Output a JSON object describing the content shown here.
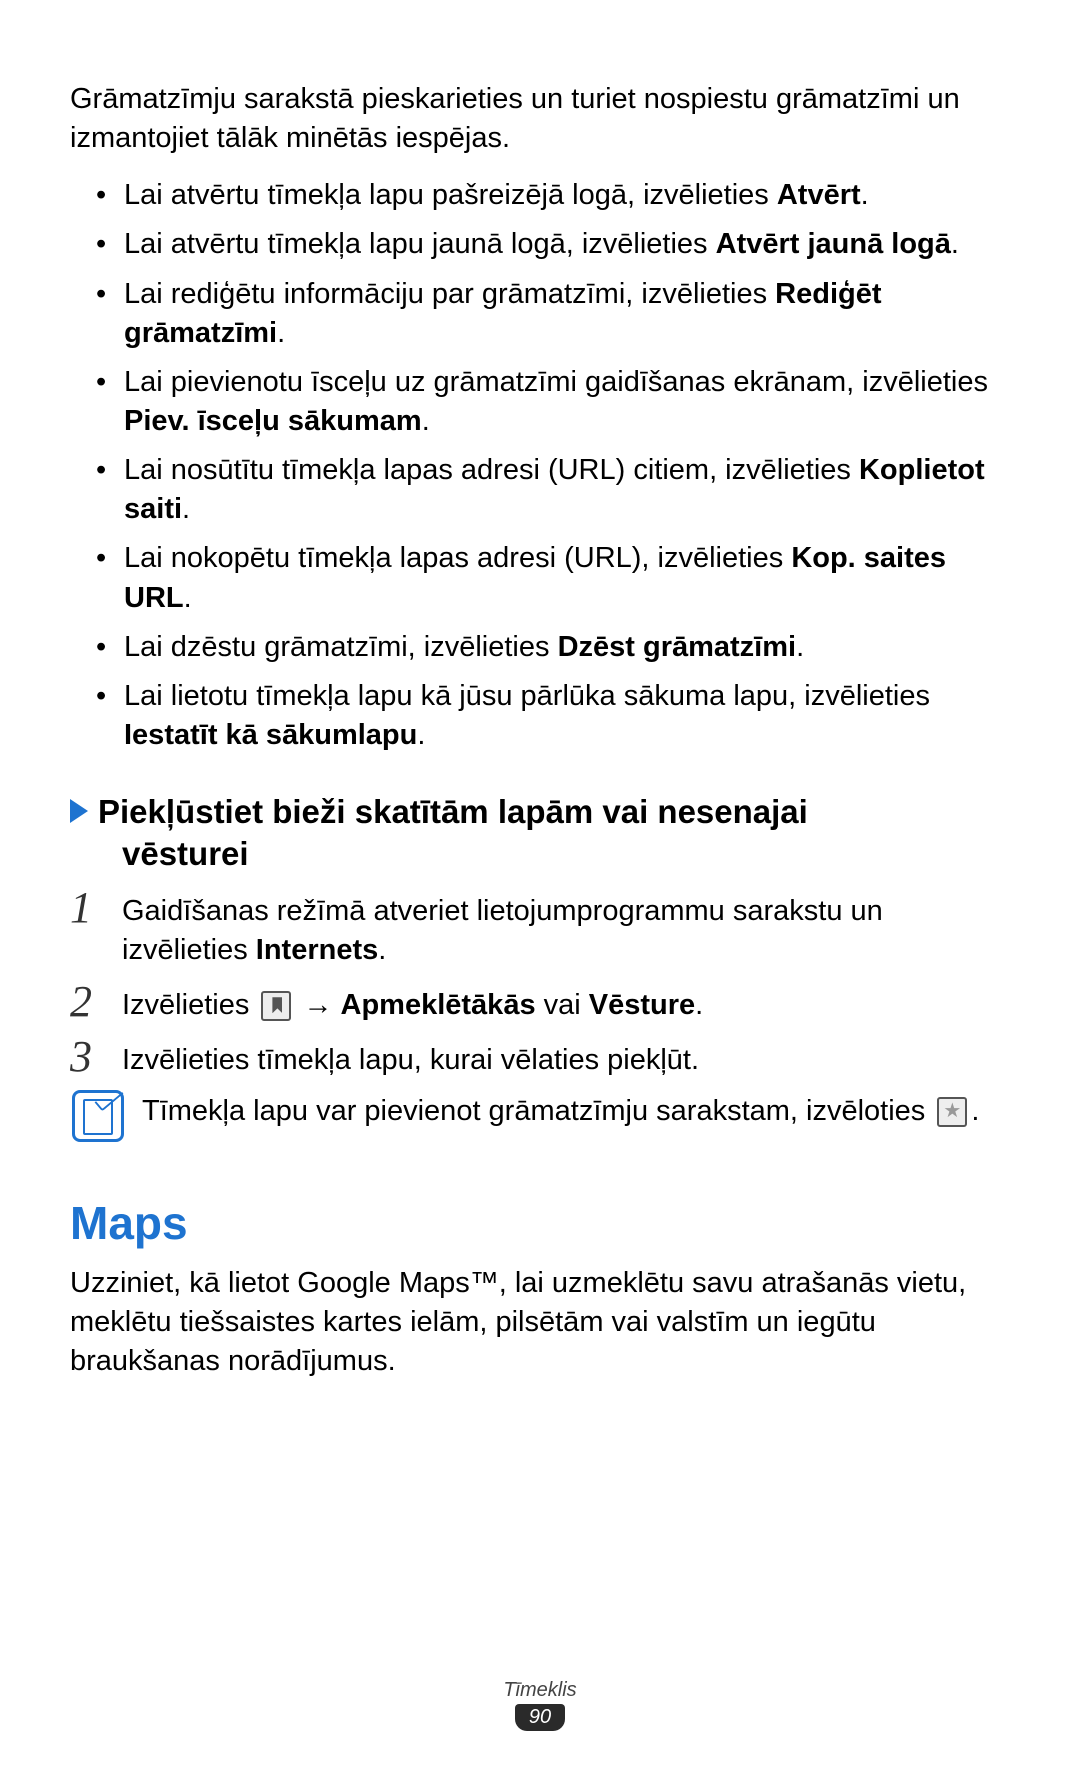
{
  "intro": "Grāmatzīmju sarakstā pieskarieties un turiet nospiestu grāmatzīmi un izmantojiet tālāk minētās iespējas.",
  "bullets": [
    {
      "t": "Lai atvērtu tīmekļa lapu pašreizējā logā, izvēlieties ",
      "b": "Atvērt",
      "a": "."
    },
    {
      "t": "Lai atvērtu tīmekļa lapu jaunā logā, izvēlieties ",
      "b": "Atvērt jaunā logā",
      "a": "."
    },
    {
      "t": "Lai rediģētu informāciju par grāmatzīmi, izvēlieties ",
      "b": "Rediģēt grāmatzīmi",
      "a": "."
    },
    {
      "t": "Lai pievienotu īsceļu uz grāmatzīmi gaidīšanas ekrānam, izvēlieties ",
      "b": "Piev. īsceļu sākumam",
      "a": "."
    },
    {
      "t": "Lai nosūtītu tīmekļa lapas adresi (URL) citiem, izvēlieties ",
      "b": "Koplietot saiti",
      "a": "."
    },
    {
      "t": "Lai nokopētu tīmekļa lapas adresi (URL), izvēlieties ",
      "b": "Kop. saites URL",
      "a": "."
    },
    {
      "t": "Lai dzēstu grāmatzīmi, izvēlieties ",
      "b": "Dzēst grāmatzīmi",
      "a": "."
    },
    {
      "t": "Lai lietotu tīmekļa lapu kā jūsu pārlūka sākuma lapu, izvēlieties ",
      "b": "Iestatīt kā sākumlapu",
      "a": "."
    }
  ],
  "subhead_l1": "Piekļūstiet bieži skatītām lapām vai nesenajai",
  "subhead_l2": "vēsturei",
  "steps": {
    "s1": {
      "num": "1",
      "text_a": "Gaidīšanas režīmā atveriet lietojumprogrammu sarakstu un izvēlieties ",
      "bold": "Internets",
      "text_b": "."
    },
    "s2": {
      "num": "2",
      "pre": "Izvēlieties ",
      "arrow": " → ",
      "b1": "Apmeklētākās",
      "mid": " vai ",
      "b2": "Vēsture",
      "post": "."
    },
    "s3": {
      "num": "3",
      "text": "Izvēlieties tīmekļa lapu, kurai vēlaties piekļūt."
    }
  },
  "note": {
    "pre": "Tīmekļa lapu var pievienot grāmatzīmju sarakstam, izvēloties ",
    "post": "."
  },
  "maps": {
    "title": "Maps",
    "para": "Uzziniet, kā lietot Google Maps™, lai uzmeklētu savu atrašanās vietu, meklētu tiešsaistes kartes ielām, pilsētām vai valstīm un iegūtu braukšanas norādījumus."
  },
  "footer": {
    "section": "Tīmeklis",
    "page": "90"
  }
}
